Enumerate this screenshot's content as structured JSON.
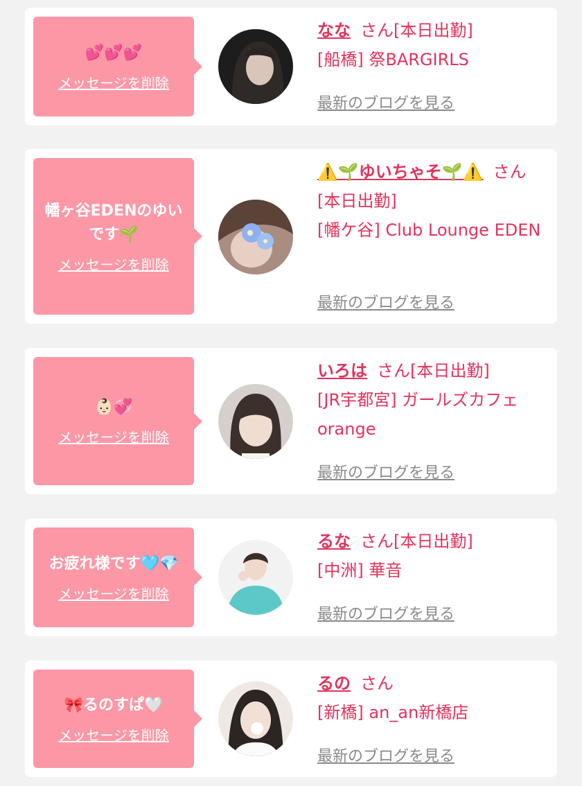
{
  "colors": {
    "page_bg": "#f2f2f2",
    "card_bg": "#ffffff",
    "bubble_bg": "#fc97a6",
    "name_color": "#e0335d",
    "blog_link_color": "#8a8a8a"
  },
  "common": {
    "delete_label": "メッセージを削除",
    "blog_label": "最新のブログを見る",
    "honorific": "さん",
    "today_badge": "[本日出勤]"
  },
  "messages": [
    {
      "message": "💕💕💕",
      "name": "なな",
      "attendance": "[本日出勤]",
      "area": "[船橋]",
      "shop": "祭BARGIRLS",
      "avatar_icon": "avatar-photo-dark-hair"
    },
    {
      "message": "幡ヶ谷EDENのゆいです🌱",
      "name": "⚠️🌱ゆいちゃそ🌱⚠️",
      "attendance": "[本日出勤]",
      "area": "[幡ケ谷]",
      "shop": "Club Lounge EDEN",
      "avatar_icon": "avatar-photo-blue-flowers"
    },
    {
      "message": "👶🏻💞",
      "name": "いろは",
      "attendance": "[本日出勤]",
      "area": "[JR宇都宮]",
      "shop": "ガールズカフェ orange",
      "avatar_icon": "avatar-photo-bangs"
    },
    {
      "message": "お疲れ様です🩵💎",
      "name": "るな",
      "attendance": "[本日出勤]",
      "area": "[中洲]",
      "shop": "華音",
      "avatar_icon": "avatar-photo-teal-shirt"
    },
    {
      "message": "🎀るのすぱ🤍",
      "name": "るの",
      "attendance": "",
      "area": "[新橋]",
      "shop": "an_an新橋店",
      "avatar_icon": "avatar-photo-white-outfit"
    }
  ]
}
